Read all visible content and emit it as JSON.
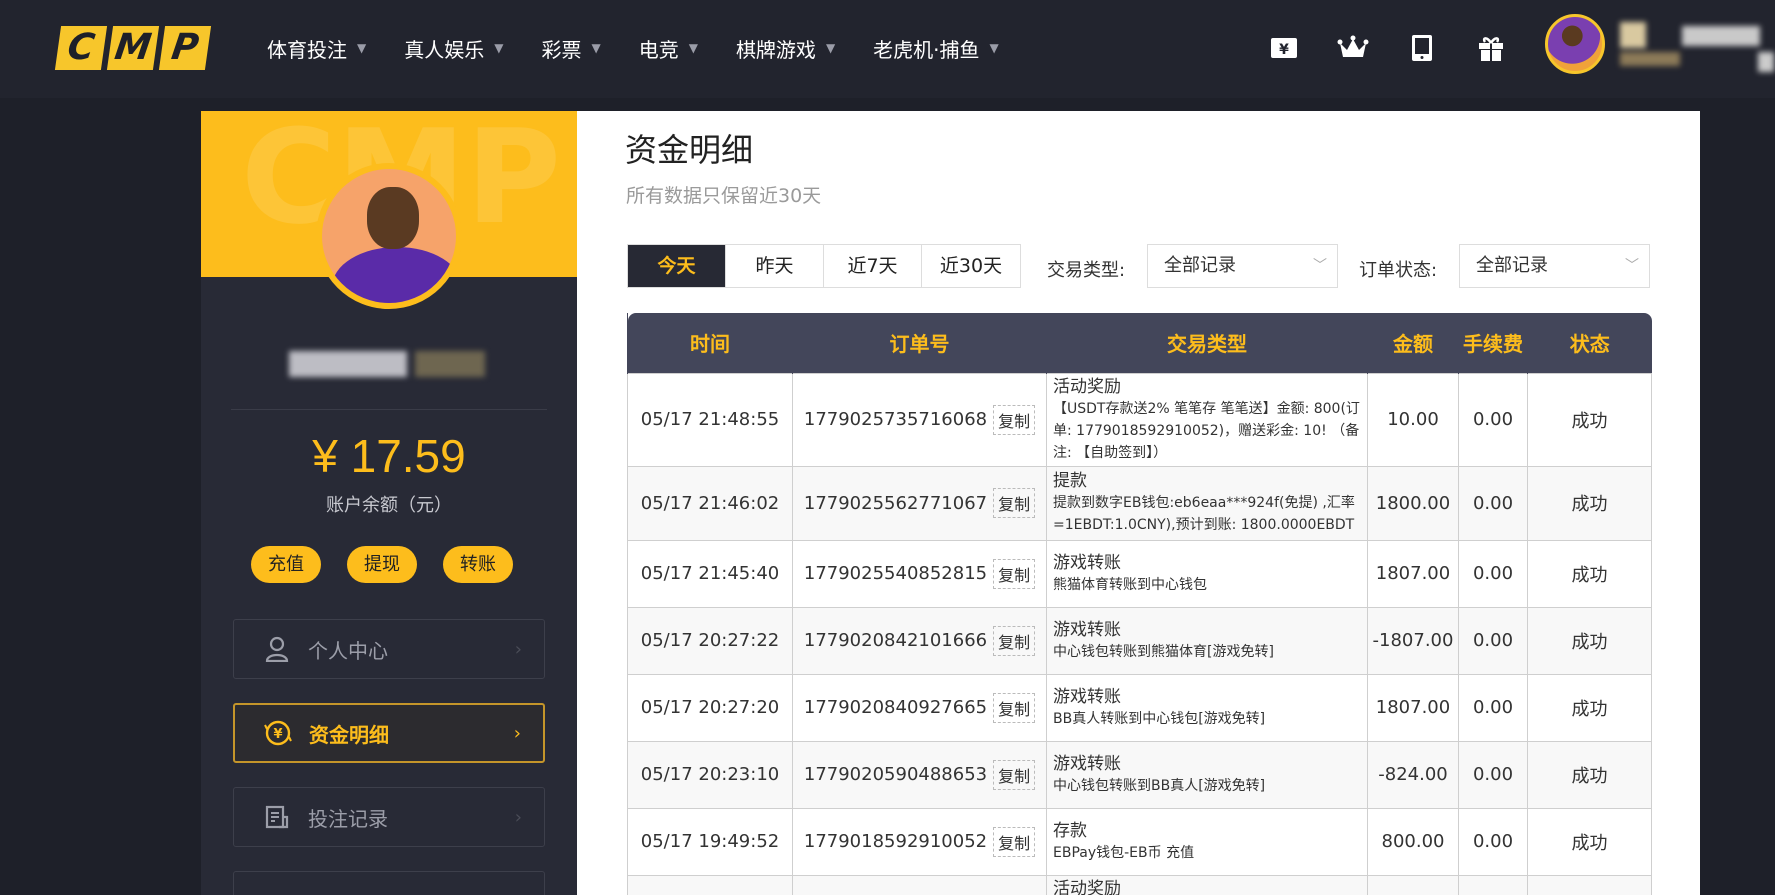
{
  "logo": {
    "letters": [
      "C",
      "M",
      "P"
    ]
  },
  "nav": [
    {
      "label": "体育投注"
    },
    {
      "label": "真人娱乐"
    },
    {
      "label": "彩票"
    },
    {
      "label": "电竞"
    },
    {
      "label": "棋牌游戏"
    },
    {
      "label": "老虎机·捕鱼"
    }
  ],
  "header_icons": [
    "yuan-ticket-icon",
    "crown-icon",
    "tablet-icon",
    "gift-icon"
  ],
  "sidebar": {
    "balance": "¥ 17.59",
    "balance_label": "账户余额（元）",
    "buttons": {
      "deposit": "充值",
      "withdraw": "提现",
      "transfer": "转账"
    },
    "menu": [
      {
        "label": "个人中心",
        "icon": "user-icon"
      },
      {
        "label": "资金明细",
        "icon": "yuan-circle-icon"
      },
      {
        "label": "投注记录",
        "icon": "bet-record-icon"
      }
    ]
  },
  "main": {
    "title": "资金明细",
    "subtitle": "所有数据只保留近30天",
    "tabs": [
      "今天",
      "昨天",
      "近7天",
      "近30天"
    ],
    "filters": {
      "type_label": "交易类型:",
      "type_value": "全部记录",
      "status_label": "订单状态:",
      "status_value": "全部记录"
    },
    "table": {
      "headers": [
        "时间",
        "订单号",
        "交易类型",
        "金额",
        "手续费",
        "状态"
      ],
      "copy_label": "复制",
      "rows": [
        {
          "time": "05/17 21:48:55",
          "order": "1779025735716068",
          "type": "活动奖励",
          "detail": "【USDT存款送2% 笔笔存 笔笔送】金额: 800(订单: 1779018592910052)，赠送彩金: 10! （备注: 【自助签到】）",
          "amount": "10.00",
          "fee": "0.00",
          "status": "成功"
        },
        {
          "time": "05/17 21:46:02",
          "order": "1779025562771067",
          "type": "提款",
          "detail": "提款到数字EB钱包:eb6eaa***924f(免提) ,汇率=1EBDT:1.0CNY),预计到账: 1800.0000EBDT",
          "amount": "1800.00",
          "fee": "0.00",
          "status": "成功"
        },
        {
          "time": "05/17 21:45:40",
          "order": "1779025540852815",
          "type": "游戏转账",
          "detail": "熊猫体育转账到中心钱包",
          "amount": "1807.00",
          "fee": "0.00",
          "status": "成功"
        },
        {
          "time": "05/17 20:27:22",
          "order": "1779020842101666",
          "type": "游戏转账",
          "detail": "中心钱包转账到熊猫体育[游戏免转]",
          "amount": "-1807.00",
          "fee": "0.00",
          "status": "成功"
        },
        {
          "time": "05/17 20:27:20",
          "order": "1779020840927665",
          "type": "游戏转账",
          "detail": "BB真人转账到中心钱包[游戏免转]",
          "amount": "1807.00",
          "fee": "0.00",
          "status": "成功"
        },
        {
          "time": "05/17 20:23:10",
          "order": "1779020590488653",
          "type": "游戏转账",
          "detail": "中心钱包转账到BB真人[游戏免转]",
          "amount": "-824.00",
          "fee": "0.00",
          "status": "成功"
        },
        {
          "time": "05/17 19:49:52",
          "order": "1779018592910052",
          "type": "存款",
          "detail": "EBPay钱包-EB币 充值",
          "amount": "800.00",
          "fee": "0.00",
          "status": "成功"
        },
        {
          "time": "",
          "order": "",
          "type": "活动奖励",
          "detail": "",
          "amount": "",
          "fee": "",
          "status": ""
        }
      ]
    }
  }
}
